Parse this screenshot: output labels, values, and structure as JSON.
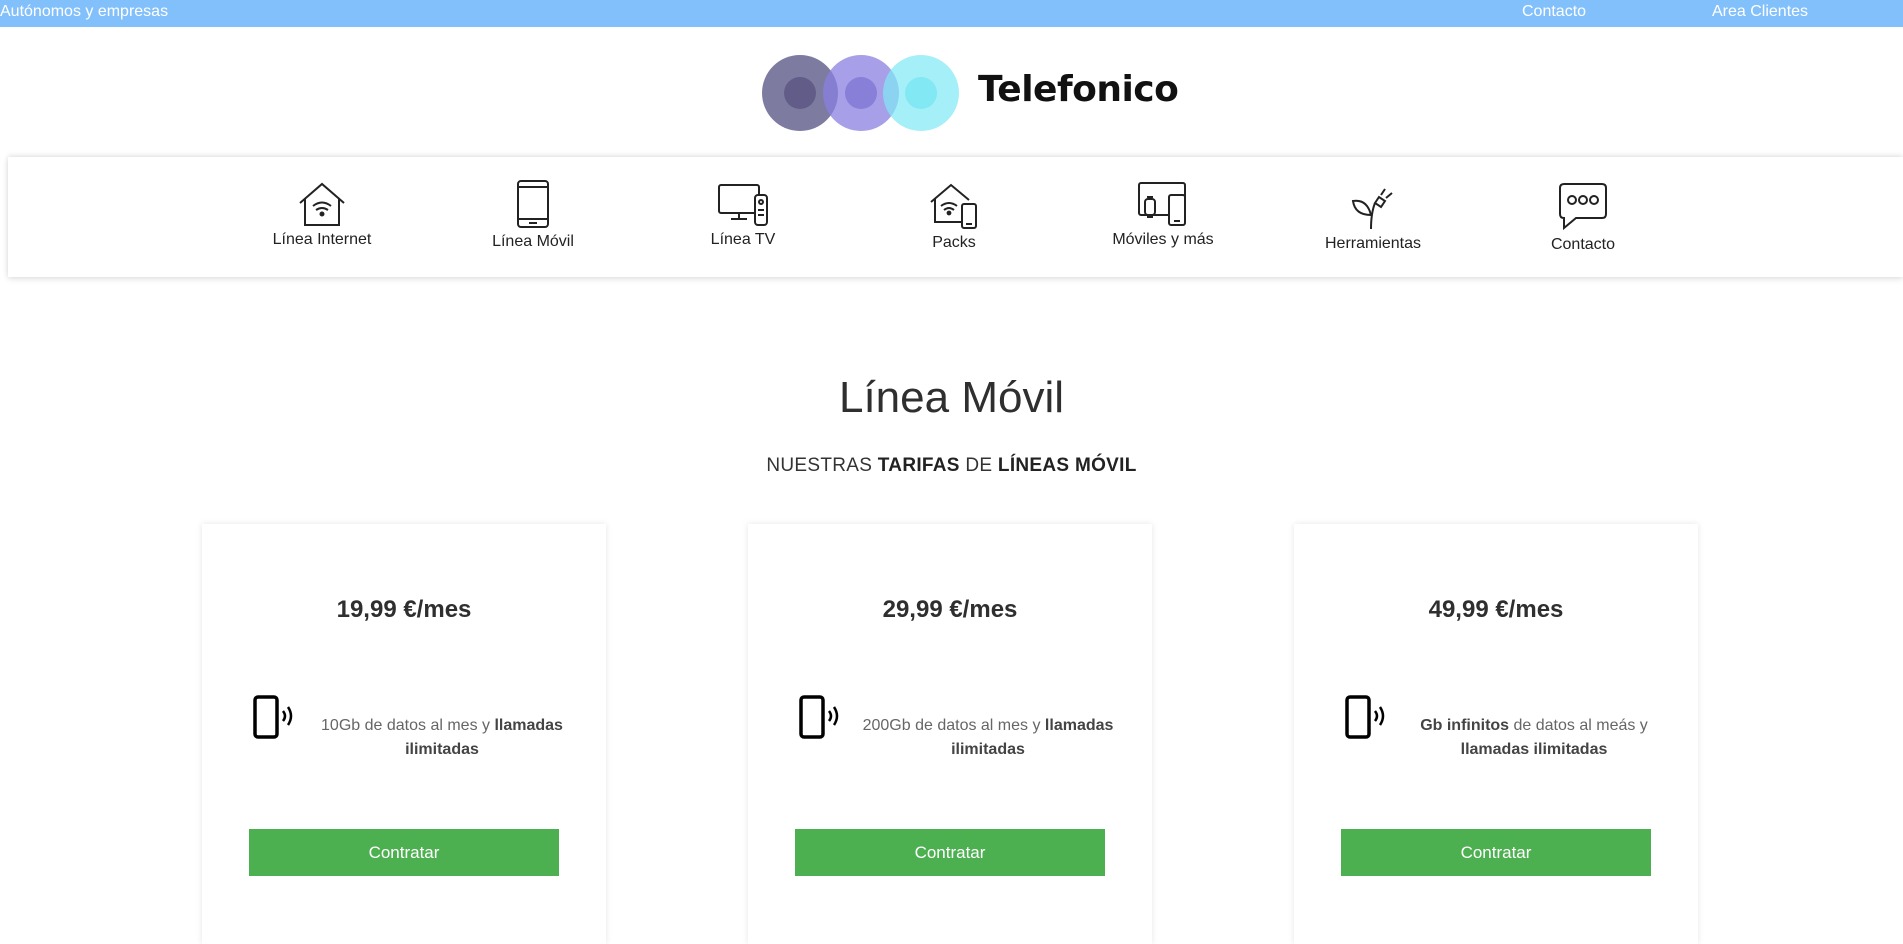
{
  "topbar": {
    "left_link": "Autónomos y empresas",
    "contact_link": "Contacto",
    "clients_link": "Area Clientes"
  },
  "brand": {
    "name": "Telefonico"
  },
  "nav": [
    {
      "label": "Línea Internet",
      "icon": "house-wifi-icon"
    },
    {
      "label": "Línea Móvil",
      "icon": "smartphone-icon"
    },
    {
      "label": "Línea TV",
      "icon": "tv-remote-icon"
    },
    {
      "label": "Packs",
      "icon": "house-phone-icon"
    },
    {
      "label": "Móviles y más",
      "icon": "devices-icon"
    },
    {
      "label": "Herramientas",
      "icon": "plant-plug-icon"
    },
    {
      "label": "Contacto",
      "icon": "chat-bubble-icon"
    }
  ],
  "hero": {
    "title": "Línea Móvil",
    "subtitle": {
      "p1": "NUESTRAS ",
      "b1": "TARIFAS",
      "p2": " DE ",
      "b2": "LÍNEAS MÓVIL"
    }
  },
  "plans": [
    {
      "price": "19,99 €/mes",
      "d1": "10Gb de datos al mes y ",
      "b1": "llamadas ilimitadas",
      "d2": "",
      "b2": "",
      "button": "Contratar"
    },
    {
      "price": "29,99 €/mes",
      "d1": "200Gb de datos al mes y ",
      "b1": "llamadas ilimitadas",
      "d2": "",
      "b2": "",
      "button": "Contratar"
    },
    {
      "price": "49,99 €/mes",
      "d1": "",
      "b1": "Gb infinitos",
      "d2": " de datos al meás y ",
      "b2": "llamadas ilimitadas",
      "button": "Contratar"
    }
  ],
  "colors": {
    "topbar": "#82c0fc",
    "button": "#4caf50",
    "logo_circle_1": "#5e5a8a",
    "logo_circle_2": "#8a7fe0",
    "logo_circle_3": "#7feaf5"
  }
}
